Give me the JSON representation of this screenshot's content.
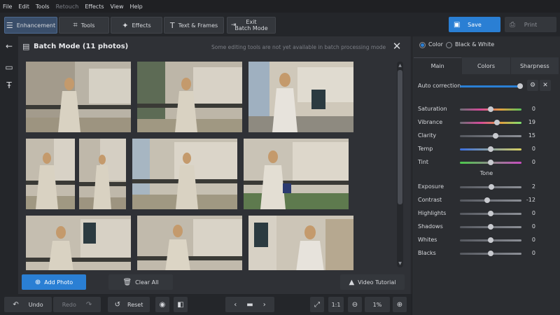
{
  "menu": [
    "File",
    "Edit",
    "Tools",
    "Retouch",
    "Effects",
    "View",
    "Help"
  ],
  "toolbar": {
    "enhancement": "Enhancement",
    "tools": "Tools",
    "effects": "Effects",
    "text_frames": "Text & Frames",
    "exit_line1": "Exit",
    "exit_line2": "Batch Mode",
    "save": "Save",
    "print": "Print"
  },
  "batch": {
    "title": "Batch Mode (11 photos)",
    "note": "Some editing tools are not yet available in batch processing mode",
    "add_photo": "Add Photo",
    "clear_all": "Clear All",
    "video_tutorial": "Video Tutorial"
  },
  "bottom": {
    "undo": "Undo",
    "redo": "Redo",
    "reset": "Reset",
    "ratio": "1:1",
    "zoom": "1%"
  },
  "right": {
    "mode_color": "Color",
    "mode_bw": "Black & White",
    "tabs": [
      "Main",
      "Colors",
      "Sharpness"
    ],
    "auto_correction": "Auto correction",
    "tone_heading": "Tone",
    "sliders": [
      {
        "label": "Saturation",
        "value": "0",
        "level": 0.5,
        "gradient": "linear-gradient(90deg,#6b6e75,#d64a9a,#e0a040,#5bc25b)"
      },
      {
        "label": "Vibrance",
        "value": "19",
        "level": 0.6,
        "gradient": "linear-gradient(90deg,#6b6e75,#d64a9a,#e0a040,#7fe070)"
      },
      {
        "label": "Clarity",
        "value": "15",
        "level": 0.58,
        "gradient": "linear-gradient(90deg,#55585f,#8c8f96)"
      },
      {
        "label": "Temp",
        "value": "0",
        "level": 0.5,
        "gradient": "linear-gradient(90deg,#3b6fe0,#d8d060)"
      },
      {
        "label": "Tint",
        "value": "0",
        "level": 0.5,
        "gradient": "linear-gradient(90deg,#4cc94c,#c94cc0)"
      },
      {
        "label": "Exposure",
        "value": "2",
        "level": 0.51,
        "gradient": "linear-gradient(90deg,#55585f,#8c8f96)"
      },
      {
        "label": "Contrast",
        "value": "-12",
        "level": 0.44,
        "gradient": "linear-gradient(90deg,#55585f,#8c8f96)"
      },
      {
        "label": "Highlights",
        "value": "0",
        "level": 0.5,
        "gradient": "linear-gradient(90deg,#55585f,#8c8f96)"
      },
      {
        "label": "Shadows",
        "value": "0",
        "level": 0.5,
        "gradient": "linear-gradient(90deg,#55585f,#8c8f96)"
      },
      {
        "label": "Whites",
        "value": "0",
        "level": 0.5,
        "gradient": "linear-gradient(90deg,#55585f,#8c8f96)"
      },
      {
        "label": "Blacks",
        "value": "0",
        "level": 0.5,
        "gradient": "linear-gradient(90deg,#55585f,#8c8f96)"
      }
    ]
  },
  "colors": {
    "accent": "#2a7fd4",
    "panel": "#2f3136",
    "toolbar": "#24262a"
  }
}
